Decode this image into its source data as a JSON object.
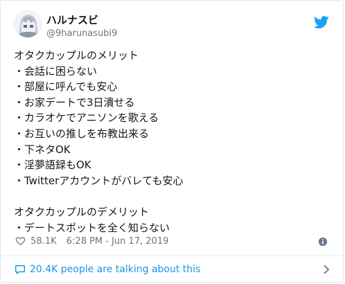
{
  "author": {
    "display_name": "ハルナスビ",
    "handle": "@9harunasubi9"
  },
  "tweet": {
    "lines": [
      "オタクカップルのメリット",
      "・会話に困らない",
      "・部屋に呼んでも安心",
      "・お家デートで3日潰せる",
      "・カラオケでアニソンを歌える",
      "・お互いの推しを布教出来る",
      "・下ネタOK",
      "・淫夢語録もOK",
      "・Twitterアカウントがバレても安心",
      "",
      "オタクカップルのデメリット",
      "・デートスポットを全く知らない"
    ]
  },
  "meta": {
    "like_count": "58.1K",
    "timestamp": "6:28 PM - Jun 17, 2019"
  },
  "conversation": {
    "label": "20.4K people are talking about this"
  },
  "icons": {
    "brand": "twitter-bird-icon",
    "like": "heart-icon",
    "info": "info-icon",
    "conversation": "chat-bubble-icon",
    "expand": "chevron-right-icon"
  },
  "colors": {
    "brand_blue": "#1da1f2",
    "link_blue": "#1b95e0",
    "secondary_text": "#657786",
    "primary_text": "#14171a",
    "border": "#e1e8ed"
  }
}
